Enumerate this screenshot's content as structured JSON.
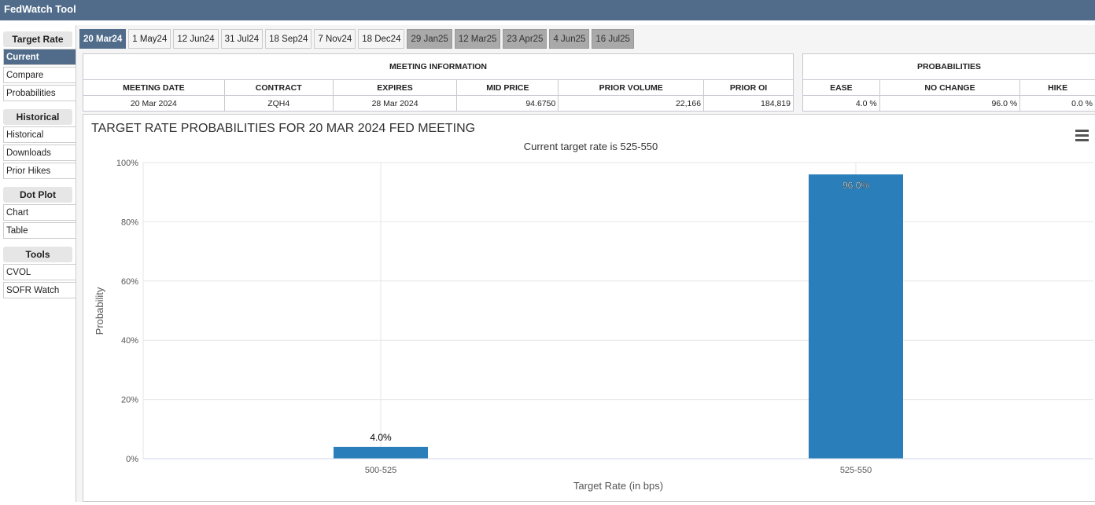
{
  "app_title": "FedWatch Tool",
  "sidebar": [
    {
      "header": "Target Rate",
      "items": [
        "Current",
        "Compare",
        "Probabilities"
      ]
    },
    {
      "header": "Historical",
      "items": [
        "Historical",
        "Downloads",
        "Prior Hikes"
      ]
    },
    {
      "header": "Dot Plot",
      "items": [
        "Chart",
        "Table"
      ]
    },
    {
      "header": "Tools",
      "items": [
        "CVOL",
        "SOFR Watch"
      ]
    }
  ],
  "tabs": [
    {
      "label": "20 Mar24",
      "state": "active"
    },
    {
      "label": "1 May24",
      "state": "normal"
    },
    {
      "label": "12 Jun24",
      "state": "normal"
    },
    {
      "label": "31 Jul24",
      "state": "normal"
    },
    {
      "label": "18 Sep24",
      "state": "normal"
    },
    {
      "label": "7 Nov24",
      "state": "normal"
    },
    {
      "label": "18 Dec24",
      "state": "normal"
    },
    {
      "label": "29 Jan25",
      "state": "disabled"
    },
    {
      "label": "12 Mar25",
      "state": "disabled"
    },
    {
      "label": "23 Apr25",
      "state": "disabled"
    },
    {
      "label": "4 Jun25",
      "state": "disabled"
    },
    {
      "label": "16 Jul25",
      "state": "disabled"
    }
  ],
  "meeting_info": {
    "title": "MEETING INFORMATION",
    "headers": [
      "MEETING DATE",
      "CONTRACT",
      "EXPIRES",
      "MID PRICE",
      "PRIOR VOLUME",
      "PRIOR OI"
    ],
    "values": [
      "20 Mar 2024",
      "ZQH4",
      "28 Mar 2024",
      "94.6750",
      "22,166",
      "184,819"
    ]
  },
  "probabilities": {
    "title": "PROBABILITIES",
    "headers": [
      "EASE",
      "NO CHANGE",
      "HIKE"
    ],
    "values": [
      "4.0 %",
      "96.0 %",
      "0.0 %"
    ]
  },
  "chart_data": {
    "type": "bar",
    "title": "TARGET RATE PROBABILITIES FOR 20 MAR 2024 FED MEETING",
    "subtitle": "Current target rate is 525-550",
    "xlabel": "Target Rate (in bps)",
    "ylabel": "Probability",
    "categories": [
      "500-525",
      "525-550"
    ],
    "values": [
      4.0,
      96.0
    ],
    "data_labels": [
      "4.0%",
      "96.0%"
    ],
    "yticks": [
      "0%",
      "20%",
      "40%",
      "60%",
      "80%",
      "100%"
    ],
    "ylim": [
      0,
      100
    ],
    "grid": true,
    "color": "#2a7fba"
  }
}
